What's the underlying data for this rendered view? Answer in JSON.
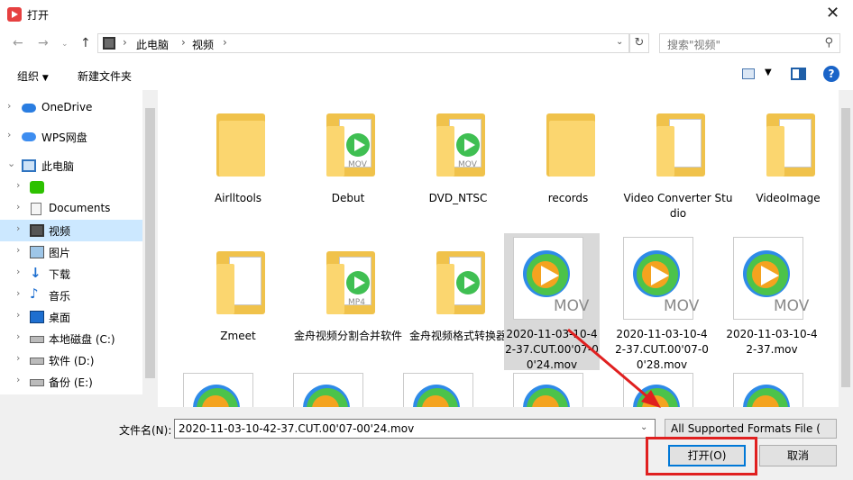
{
  "window": {
    "title": "打开"
  },
  "address": {
    "crumbs": [
      "此电脑",
      "视频"
    ]
  },
  "search": {
    "placeholder": "搜索\"视频\""
  },
  "toolbar": {
    "organize": "组织",
    "new_folder": "新建文件夹"
  },
  "sidebar": {
    "items": [
      {
        "label": "OneDrive",
        "icon": "cloud-icon"
      },
      {
        "label": "WPS网盘",
        "icon": "wps-cloud-icon"
      },
      {
        "label": "此电脑",
        "icon": "computer-icon"
      },
      {
        "label": "",
        "icon": "wechat-icon"
      },
      {
        "label": "Documents",
        "icon": "document-icon"
      },
      {
        "label": "视频",
        "icon": "video-folder-icon"
      },
      {
        "label": "图片",
        "icon": "picture-icon"
      },
      {
        "label": "下载",
        "icon": "download-icon"
      },
      {
        "label": "音乐",
        "icon": "music-icon"
      },
      {
        "label": "桌面",
        "icon": "desktop-icon"
      },
      {
        "label": "本地磁盘 (C:)",
        "icon": "drive-icon"
      },
      {
        "label": "软件 (D:)",
        "icon": "drive-icon"
      },
      {
        "label": "备份 (E:)",
        "icon": "drive-icon"
      }
    ]
  },
  "files": [
    {
      "name": "Airlltools",
      "type": "folder"
    },
    {
      "name": "Debut",
      "type": "folder-video",
      "ext": "MOV"
    },
    {
      "name": "DVD_NTSC",
      "type": "folder-video",
      "ext": "MOV"
    },
    {
      "name": "records",
      "type": "folder"
    },
    {
      "name": "Video Converter Studio",
      "type": "folder-doc"
    },
    {
      "name": "VideoImage",
      "type": "folder-doc"
    },
    {
      "name": "Zmeet",
      "type": "folder-doc"
    },
    {
      "name": "金舟视频分割合并软件",
      "type": "folder-video",
      "ext": "MP4"
    },
    {
      "name": "金舟视频格式转换器",
      "type": "folder-video",
      "ext": ""
    },
    {
      "name": "2020-11-03-10-42-37.CUT.00'07-00'24.mov",
      "type": "video",
      "ext": "MOV"
    },
    {
      "name": "2020-11-03-10-42-37.CUT.00'07-00'28.mov",
      "type": "video",
      "ext": "MOV"
    },
    {
      "name": "2020-11-03-10-42-37.mov",
      "type": "video",
      "ext": "MOV"
    }
  ],
  "footer": {
    "filename_label": "文件名(N):",
    "filename_value": "2020-11-03-10-42-37.CUT.00'07-00'24.mov",
    "filter": "All Supported Formats File (",
    "open": "打开(O)",
    "cancel": "取消"
  },
  "colors": {
    "selection": "#cce8ff",
    "annotation": "#e02020",
    "accent": "#0078d7"
  }
}
